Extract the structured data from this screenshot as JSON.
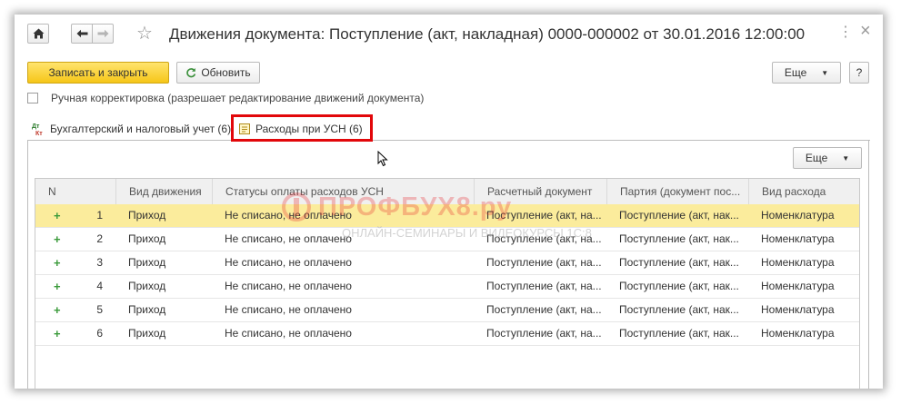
{
  "window": {
    "title": "Движения документа: Поступление (акт, накладная) 0000-000002 от 30.01.2016 12:00:00",
    "more_glyph": "⋮",
    "close_glyph": "×"
  },
  "toolbar": {
    "save_close_label": "Записать и закрыть",
    "refresh_label": "Обновить",
    "more_label": "Еще",
    "help_label": "?"
  },
  "manual_correction": {
    "label": "Ручная корректировка (разрешает редактирование движений документа)",
    "checked": false
  },
  "tabs": [
    {
      "label": "Бухгалтерский и налоговый учет (6)",
      "active": false
    },
    {
      "label": "Расходы при УСН (6)",
      "active": true
    }
  ],
  "panel": {
    "more_label": "Еще"
  },
  "table": {
    "columns": [
      "N",
      "Вид движения",
      "Статусы оплаты расходов УСН",
      "Расчетный документ",
      "Партия (документ пос...",
      "Вид расхода"
    ],
    "rows": [
      {
        "n": "1",
        "kind": "Приход",
        "status": "Не списано, не оплачено",
        "doc": "Поступление (акт, на...",
        "batch": "Поступление (акт, нак...",
        "expense": "Номенклатура",
        "selected": true
      },
      {
        "n": "2",
        "kind": "Приход",
        "status": "Не списано, не оплачено",
        "doc": "Поступление (акт, на...",
        "batch": "Поступление (акт, нак...",
        "expense": "Номенклатура",
        "selected": false
      },
      {
        "n": "3",
        "kind": "Приход",
        "status": "Не списано, не оплачено",
        "doc": "Поступление (акт, на...",
        "batch": "Поступление (акт, нак...",
        "expense": "Номенклатура",
        "selected": false
      },
      {
        "n": "4",
        "kind": "Приход",
        "status": "Не списано, не оплачено",
        "doc": "Поступление (акт, на...",
        "batch": "Поступление (акт, нак...",
        "expense": "Номенклатура",
        "selected": false
      },
      {
        "n": "5",
        "kind": "Приход",
        "status": "Не списано, не оплачено",
        "doc": "Поступление (акт, на...",
        "batch": "Поступление (акт, нак...",
        "expense": "Номенклатура",
        "selected": false
      },
      {
        "n": "6",
        "kind": "Приход",
        "status": "Не списано, не оплачено",
        "doc": "Поступление (акт, на...",
        "batch": "Поступление (акт, нак...",
        "expense": "Номенклатура",
        "selected": false
      }
    ],
    "row_marker": "+"
  },
  "watermark": {
    "main": "ПРОФБУХ8.ру",
    "sub": "ОНЛАЙН-СЕМИНАРЫ И ВИДЕОКУРСЫ 1С:8"
  },
  "colors": {
    "primary_button": "#f6c618",
    "selected_row": "#fbec9c",
    "tab_highlight": "#e2070a",
    "plus": "#3a9a3a"
  }
}
